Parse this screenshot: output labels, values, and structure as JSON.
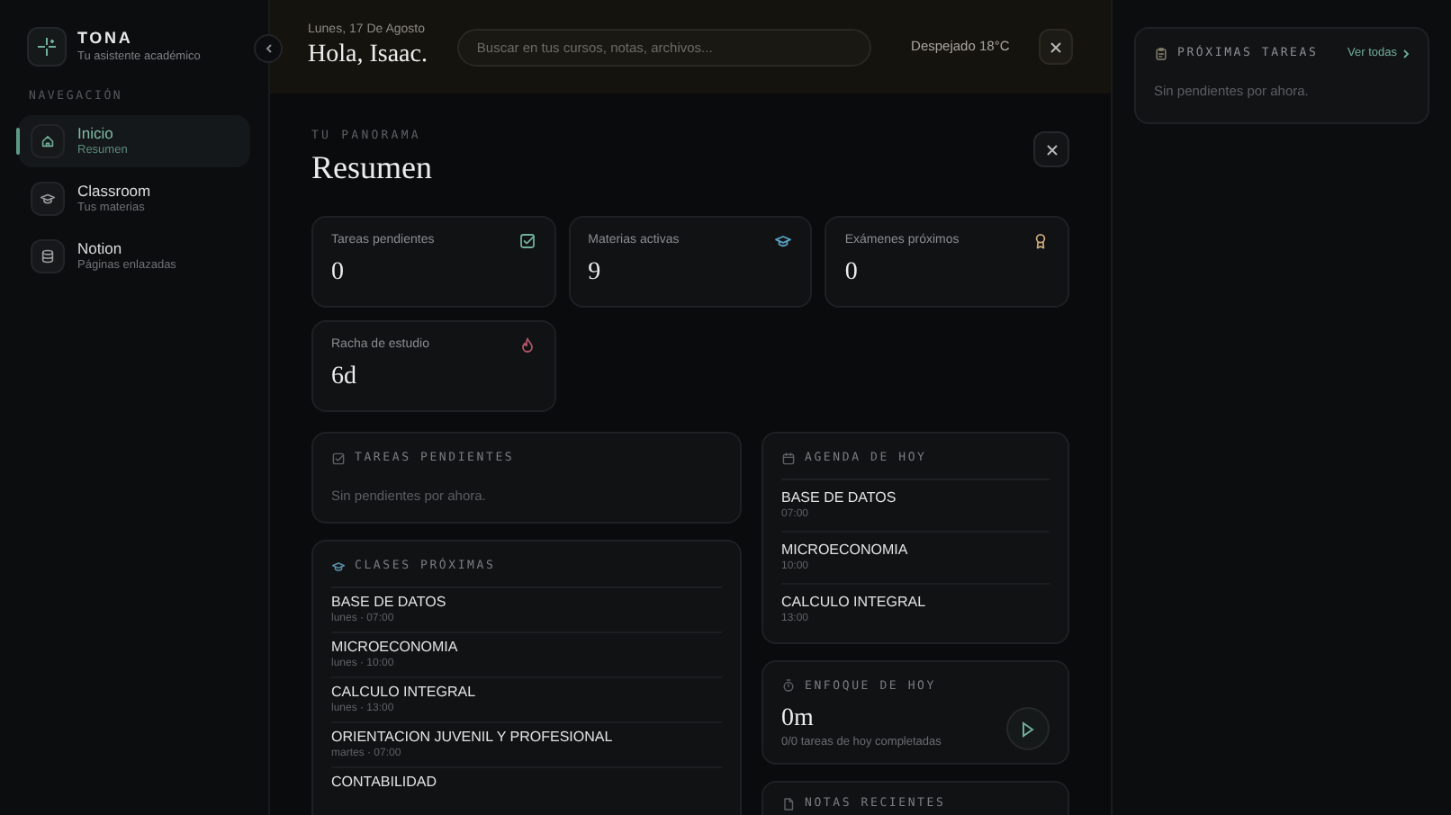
{
  "sidebar": {
    "brand": {
      "name": "TONA",
      "tagline": "Tu asistente académico"
    },
    "section_label": "NAVEGACIÓN",
    "items": [
      {
        "label": "Inicio",
        "sublabel": "Resumen",
        "selected": true
      },
      {
        "label": "Classroom",
        "sublabel": "Tus materias",
        "selected": false
      },
      {
        "label": "Notion",
        "sublabel": "Páginas enlazadas",
        "selected": false
      }
    ]
  },
  "header": {
    "date": "Lunes, 17 De Agosto",
    "greeting": "Hola, Isaac.",
    "search": {
      "placeholder": "Buscar en tus cursos, notas, archivos..."
    },
    "weather": "Despejado 18°C"
  },
  "modal": {
    "eyebrow": "TU PANORAMA",
    "title": "Resumen",
    "stats": [
      {
        "label": "Tareas pendientes",
        "value": "0",
        "color": "#6fae97"
      },
      {
        "label": "Materias activas",
        "value": "9",
        "color": "#5a9fc0"
      },
      {
        "label": "Exámenes próximos",
        "value": "0",
        "color": "#c9a877"
      },
      {
        "label": "Racha de estudio",
        "value": "6d",
        "color": "#b0566a"
      }
    ],
    "tasks": {
      "title": "TAREAS PENDIENTES",
      "empty": "Sin pendientes por ahora."
    },
    "classes": {
      "title": "CLASES PRÓXIMAS",
      "items": [
        {
          "name": "BASE DE DATOS",
          "when": "lunes · 07:00"
        },
        {
          "name": "MICROECONOMIA",
          "when": "lunes · 10:00"
        },
        {
          "name": "CALCULO INTEGRAL",
          "when": "lunes · 13:00"
        },
        {
          "name": "ORIENTACION JUVENIL Y PROFESIONAL",
          "when": "martes · 07:00"
        },
        {
          "name": "CONTABILIDAD"
        }
      ]
    },
    "agenda": {
      "title": "AGENDA DE HOY",
      "items": [
        {
          "name": "BASE DE DATOS",
          "time": "07:00"
        },
        {
          "name": "MICROECONOMIA",
          "time": "10:00"
        },
        {
          "name": "CALCULO INTEGRAL",
          "time": "13:00"
        }
      ]
    },
    "focus": {
      "title": "ENFOQUE DE HOY",
      "value": "0m",
      "caption": "0/0 tareas de hoy completadas"
    },
    "notes": {
      "title": "NOTAS RECIENTES"
    }
  },
  "right_panel": {
    "title": "PRÓXIMAS TAREAS",
    "link": "Ver todas",
    "empty": "Sin pendientes por ahora."
  }
}
